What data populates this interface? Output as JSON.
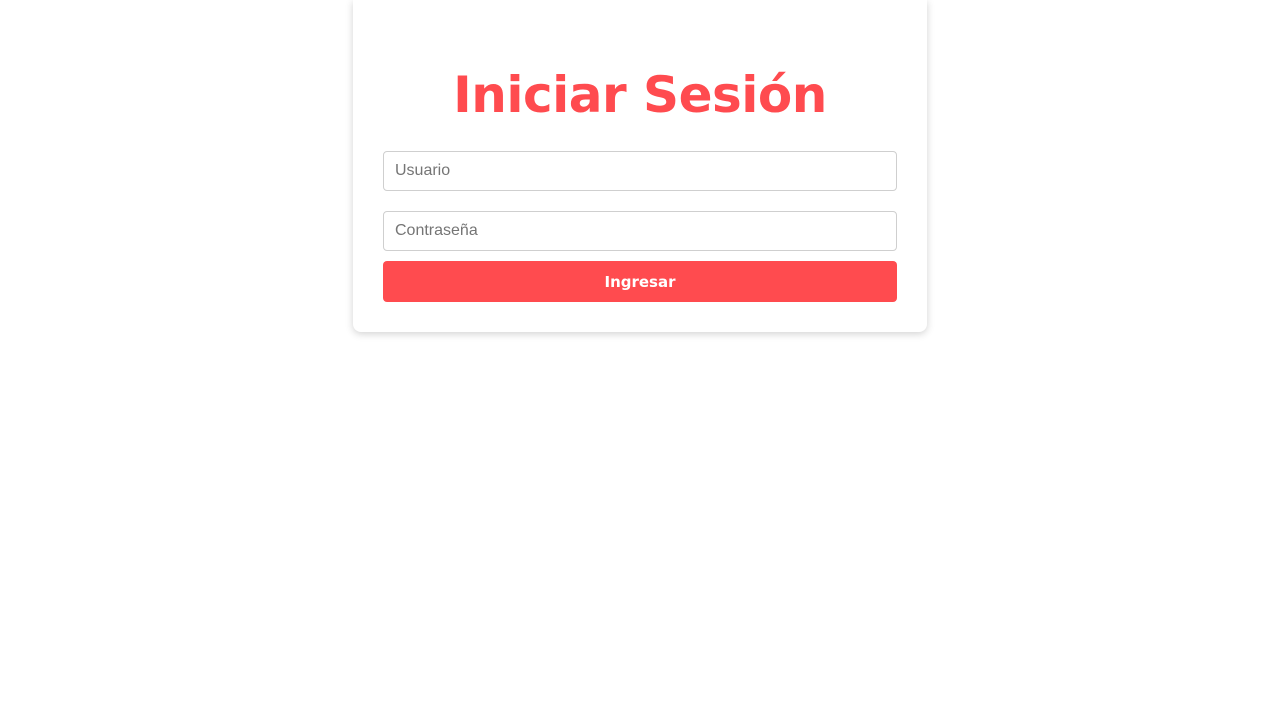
{
  "login": {
    "title": "Iniciar Sesión",
    "username_placeholder": "Usuario",
    "username_value": "",
    "password_placeholder": "Contraseña",
    "password_value": "",
    "submit_label": "Ingresar"
  },
  "colors": {
    "accent": "#ff4b4f",
    "background": "#ffffff",
    "input_border": "#cfcfcf"
  }
}
